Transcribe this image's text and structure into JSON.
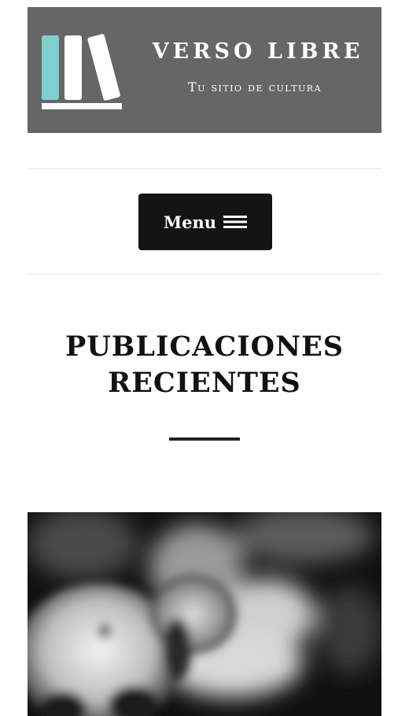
{
  "site": {
    "title": "VERSO LIBRE",
    "tagline": "Tu sitio de cultura",
    "logo_icon": "books-icon",
    "book_colors": [
      "#7ecfcf",
      "#ffffff",
      "#ffffff"
    ]
  },
  "nav": {
    "menu_label": "Menu",
    "menu_icon": "hamburger-icon"
  },
  "main": {
    "section_title": "PUBLICACIONES RECIENTES",
    "featured_post": {
      "image_description_icon": "photo-thumbnail"
    }
  },
  "colors": {
    "banner_bg": "#666666",
    "button_bg": "#141414",
    "accent": "#7ecfcf"
  }
}
